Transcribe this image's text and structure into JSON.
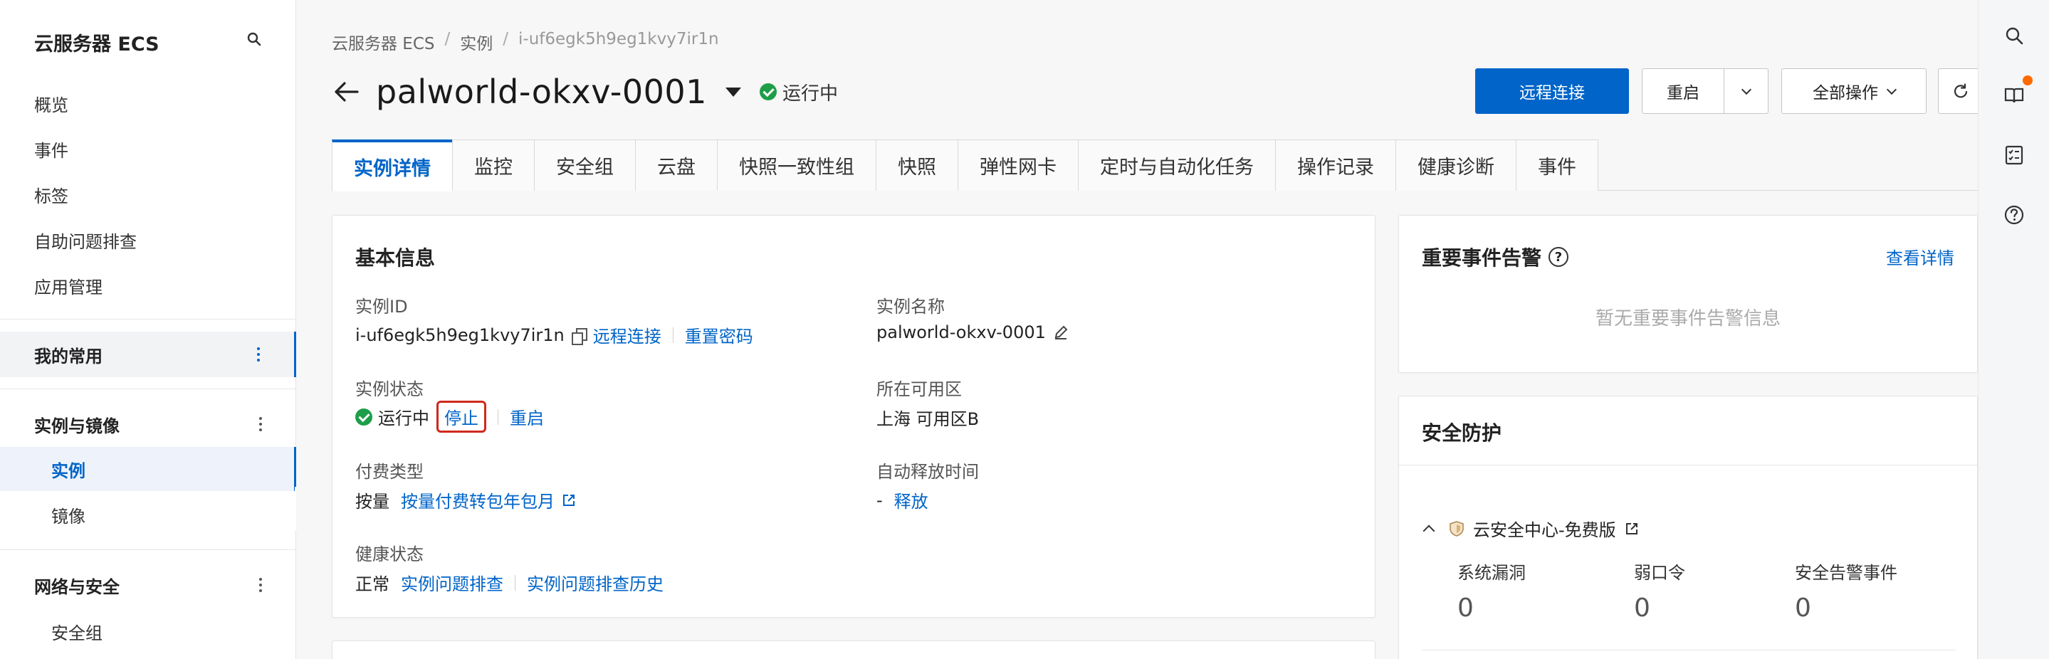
{
  "sidebar": {
    "title": "云服务器 ECS",
    "items": [
      "概览",
      "事件",
      "标签",
      "自助问题排查",
      "应用管理"
    ],
    "favorites_label": "我的常用",
    "group_instances": "实例与镜像",
    "sub_instances": [
      "实例",
      "镜像"
    ],
    "group_network": "网络与安全",
    "sub_network": [
      "安全组"
    ]
  },
  "breadcrumb": {
    "root": "云服务器 ECS",
    "section": "实例",
    "current": "i-uf6egk5h9eg1kvy7ir1n",
    "separator": "/"
  },
  "header": {
    "title": "palworld-okxv-0001",
    "status": "运行中"
  },
  "actions": {
    "remote_connect": "远程连接",
    "restart": "重启",
    "all_actions": "全部操作"
  },
  "tabs": [
    "实例详情",
    "监控",
    "安全组",
    "云盘",
    "快照一致性组",
    "快照",
    "弹性网卡",
    "定时与自动化任务",
    "操作记录",
    "健康诊断",
    "事件"
  ],
  "basic_info": {
    "title": "基本信息",
    "instance_id_label": "实例ID",
    "instance_id": "i-uf6egk5h9eg1kvy7ir1n",
    "remote_connect_link": "远程连接",
    "reset_password_link": "重置密码",
    "instance_name_label": "实例名称",
    "instance_name": "palworld-okxv-0001",
    "status_label": "实例状态",
    "status_value": "运行中",
    "stop_link": "停止",
    "restart_link": "重启",
    "zone_label": "所在可用区",
    "zone_value": "上海 可用区B",
    "billing_label": "付费类型",
    "billing_value": "按量",
    "billing_convert_link": "按量付费转包年包月",
    "auto_release_label": "自动释放时间",
    "auto_release_value": "-",
    "release_link": "释放",
    "health_label": "健康状态",
    "health_value": "正常",
    "troubleshoot_link": "实例问题排查",
    "troubleshoot_history_link": "实例问题排查历史"
  },
  "alerts": {
    "title": "重要事件告警",
    "view_details": "查看详情",
    "empty_text": "暂无重要事件告警信息"
  },
  "security": {
    "title": "安全防护",
    "center_name": "云安全中心-免费版",
    "stats": [
      {
        "label": "系统漏洞",
        "value": "0"
      },
      {
        "label": "弱口令",
        "value": "0"
      },
      {
        "label": "安全告警事件",
        "value": "0"
      }
    ]
  },
  "colors": {
    "primary": "#0064c8",
    "success": "#1e9e49",
    "highlight_box": "#d0281c",
    "notification_dot": "#ff6a00"
  }
}
